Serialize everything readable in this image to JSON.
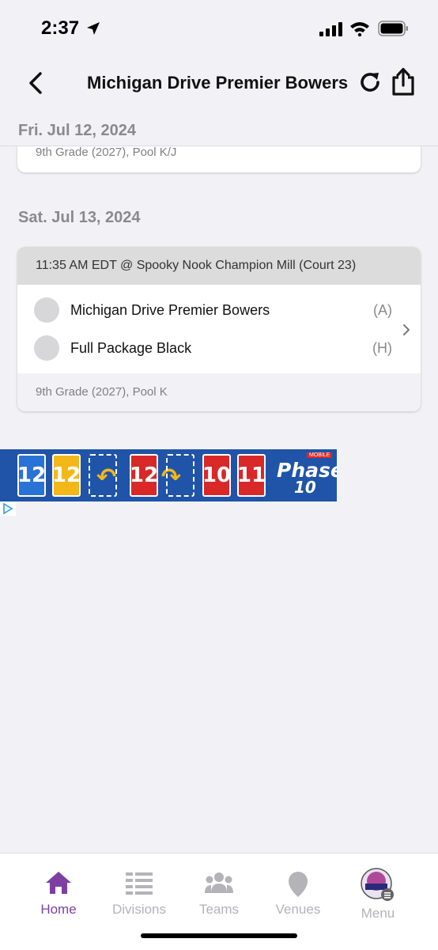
{
  "status_bar": {
    "time": "2:37"
  },
  "nav": {
    "title": "Michigan Drive Premier Bowers"
  },
  "sections": [
    {
      "date": "Fri. Jul 12, 2024",
      "footer": "9th Grade (2027), Pool K/J"
    },
    {
      "date": "Sat. Jul 13, 2024",
      "game": {
        "header": "11:35 AM EDT @ Spooky Nook Champion Mill (Court 23)",
        "teams": [
          {
            "name": "Michigan Drive Premier Bowers",
            "side": "(A)"
          },
          {
            "name": "Full Package Black",
            "side": "(H)"
          }
        ],
        "footer": "9th Grade (2027), Pool K"
      }
    }
  ],
  "ad": {
    "cards": [
      "12",
      "12",
      "",
      "12",
      "",
      "10",
      "11"
    ],
    "brand_small": "MOBILE",
    "brand": "Phase",
    "brand_num": "10"
  },
  "tabs": [
    {
      "label": "Home",
      "icon": "home-icon",
      "active": true
    },
    {
      "label": "Divisions",
      "icon": "divisions-icon",
      "active": false
    },
    {
      "label": "Teams",
      "icon": "teams-icon",
      "active": false
    },
    {
      "label": "Venues",
      "icon": "venue-pin-icon",
      "active": false
    },
    {
      "label": "Menu",
      "icon": "showcase-logo-icon",
      "active": false
    }
  ],
  "colors": {
    "accent": "#7e3fa0",
    "inactive_tab": "#b3b3b8",
    "header_gray": "#dcdcdc",
    "background": "#f2f2f6"
  }
}
